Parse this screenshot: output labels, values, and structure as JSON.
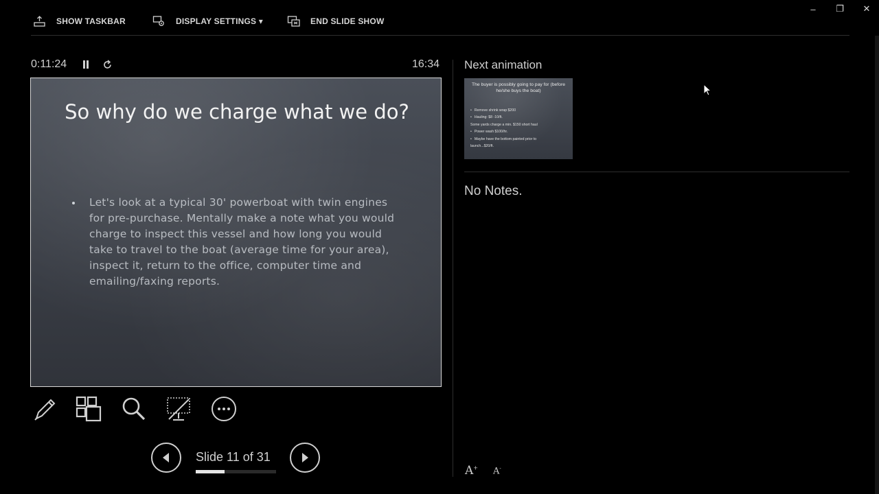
{
  "toolbar": {
    "show_taskbar": "SHOW TASKBAR",
    "display_settings": "DISPLAY SETTINGS ▾",
    "end_slide_show": "END SLIDE SHOW"
  },
  "window": {
    "minimize": "–",
    "restore": "❐",
    "close": "✕"
  },
  "presenter": {
    "elapsed": "0:11:24",
    "clock": "16:34"
  },
  "slide": {
    "title": "So why do we charge what we do?",
    "body": "Let's look at a typical 30' powerboat with twin engines for pre-purchase. Mentally make a note what you would charge to inspect this vessel and how long you would take to travel to the boat (average time for your area), inspect it, return to the office, computer time and emailing/faxing reports."
  },
  "navigation": {
    "slide_counter": "Slide 11 of 31",
    "current": 11,
    "total": 31
  },
  "next_panel": {
    "label": "Next animation",
    "thumb_title": "The buyer is possibly going to pay for (before he/she buys the boat)",
    "thumb_lines": [
      {
        "text": "Remove shrink wrap $200",
        "bullet": true
      },
      {
        "text": "Hauling:      $8 -10/ft.",
        "bullet": true
      },
      {
        "text": "Some yards charge a min. $150 short haul",
        "bullet": false
      },
      {
        "text": "Power wash    $100/hr.",
        "bullet": true
      },
      {
        "text": "Maybe have the bottom painted prior to",
        "bullet": true
      },
      {
        "text": "launch...$20/ft.",
        "bullet": false
      }
    ]
  },
  "notes": {
    "text": "No Notes."
  },
  "font_controls": {
    "increase": "A",
    "decrease": "A"
  }
}
